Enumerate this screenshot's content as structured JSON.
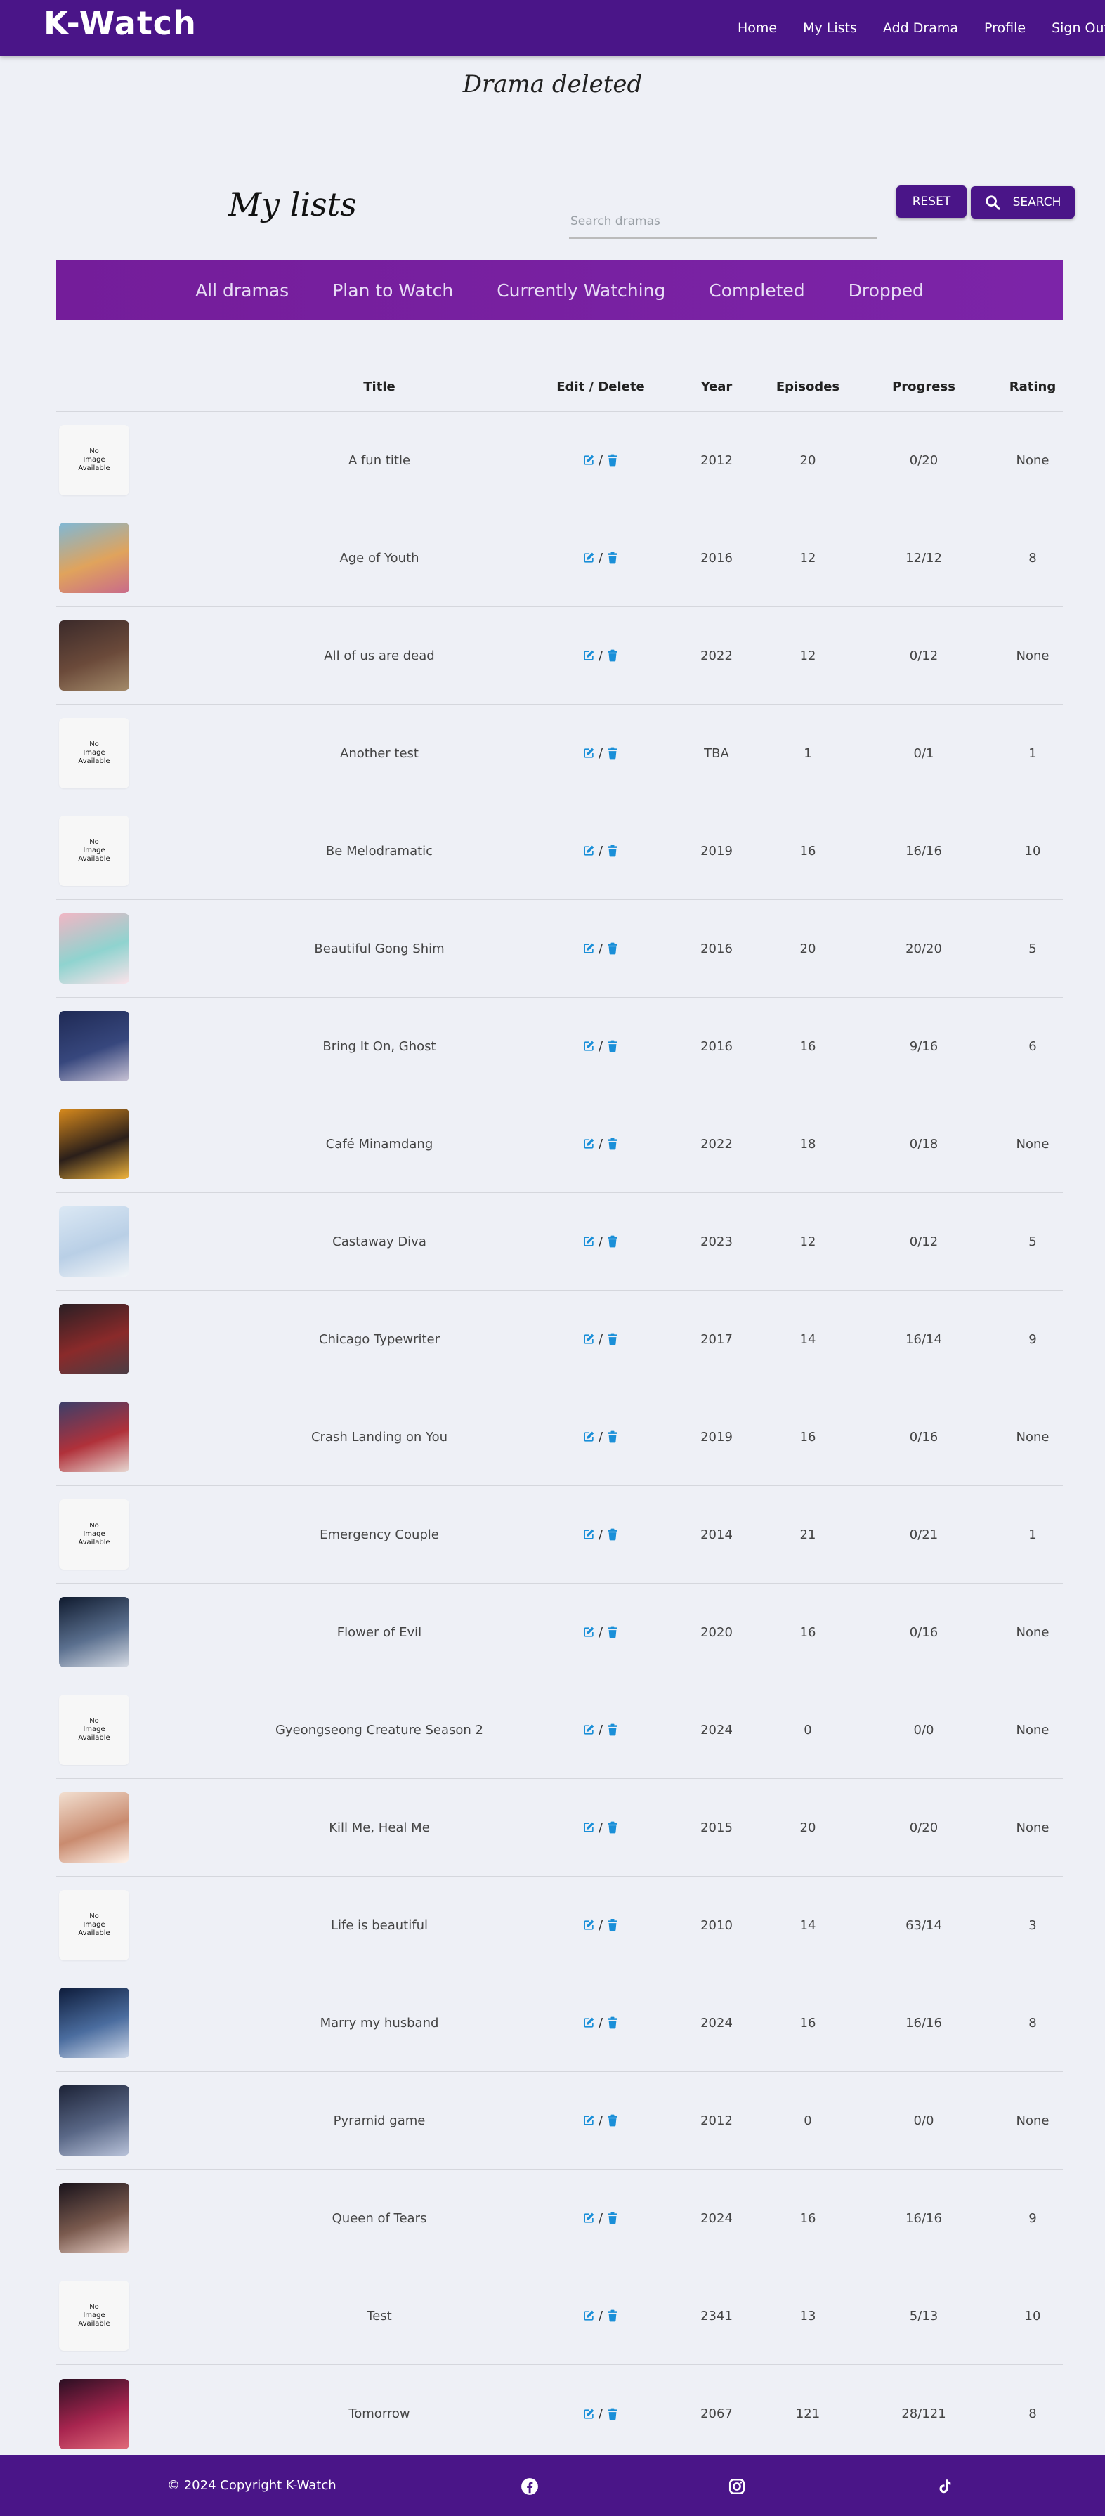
{
  "brand": "K-Watch",
  "nav": [
    "Home",
    "My Lists",
    "Add Drama",
    "Profile",
    "Sign Out"
  ],
  "flash": "Drama deleted",
  "page_title": "My lists",
  "search": {
    "placeholder": "Search dramas",
    "reset_label": "RESET",
    "search_label": "SEARCH"
  },
  "tabs": [
    "All dramas",
    "Plan to Watch",
    "Currently Watching",
    "Completed",
    "Dropped"
  ],
  "columns": [
    "Title",
    "Edit / Delete",
    "Year",
    "Episodes",
    "Progress",
    "Rating"
  ],
  "no_image": [
    "No",
    "Image",
    "Available"
  ],
  "rows": [
    {
      "title": "A fun title",
      "year": "2012",
      "episodes": "20",
      "progress": "0/20",
      "rating": "None",
      "has_image": false
    },
    {
      "title": "Age of Youth",
      "year": "2016",
      "episodes": "12",
      "progress": "12/12",
      "rating": "8",
      "has_image": true
    },
    {
      "title": "All of us are dead",
      "year": "2022",
      "episodes": "12",
      "progress": "0/12",
      "rating": "None",
      "has_image": true
    },
    {
      "title": "Another test",
      "year": "TBA",
      "episodes": "1",
      "progress": "0/1",
      "rating": "1",
      "has_image": false
    },
    {
      "title": "Be Melodramatic",
      "year": "2019",
      "episodes": "16",
      "progress": "16/16",
      "rating": "10",
      "has_image": false
    },
    {
      "title": "Beautiful Gong Shim",
      "year": "2016",
      "episodes": "20",
      "progress": "20/20",
      "rating": "5",
      "has_image": true
    },
    {
      "title": "Bring It On, Ghost",
      "year": "2016",
      "episodes": "16",
      "progress": "9/16",
      "rating": "6",
      "has_image": true
    },
    {
      "title": "Café Minamdang",
      "year": "2022",
      "episodes": "18",
      "progress": "0/18",
      "rating": "None",
      "has_image": true
    },
    {
      "title": "Castaway Diva",
      "year": "2023",
      "episodes": "12",
      "progress": "0/12",
      "rating": "5",
      "has_image": true
    },
    {
      "title": "Chicago Typewriter",
      "year": "2017",
      "episodes": "14",
      "progress": "16/14",
      "rating": "9",
      "has_image": true
    },
    {
      "title": "Crash Landing on You",
      "year": "2019",
      "episodes": "16",
      "progress": "0/16",
      "rating": "None",
      "has_image": true
    },
    {
      "title": "Emergency Couple",
      "year": "2014",
      "episodes": "21",
      "progress": "0/21",
      "rating": "1",
      "has_image": false
    },
    {
      "title": "Flower of Evil",
      "year": "2020",
      "episodes": "16",
      "progress": "0/16",
      "rating": "None",
      "has_image": true
    },
    {
      "title": "Gyeongseong Creature Season 2",
      "year": "2024",
      "episodes": "0",
      "progress": "0/0",
      "rating": "None",
      "has_image": false
    },
    {
      "title": "Kill Me, Heal Me",
      "year": "2015",
      "episodes": "20",
      "progress": "0/20",
      "rating": "None",
      "has_image": true
    },
    {
      "title": "Life is beautiful",
      "year": "2010",
      "episodes": "14",
      "progress": "63/14",
      "rating": "3",
      "has_image": false
    },
    {
      "title": "Marry my husband",
      "year": "2024",
      "episodes": "16",
      "progress": "16/16",
      "rating": "8",
      "has_image": true
    },
    {
      "title": "Pyramid game",
      "year": "2012",
      "episodes": "0",
      "progress": "0/0",
      "rating": "None",
      "has_image": true
    },
    {
      "title": "Queen of Tears",
      "year": "2024",
      "episodes": "16",
      "progress": "16/16",
      "rating": "9",
      "has_image": true
    },
    {
      "title": "Test",
      "year": "2341",
      "episodes": "13",
      "progress": "5/13",
      "rating": "10",
      "has_image": false
    },
    {
      "title": "Tomorrow",
      "year": "2067",
      "episodes": "121",
      "progress": "28/121",
      "rating": "8",
      "has_image": true
    }
  ],
  "footer": {
    "copyright": "© 2024 Copyright K-Watch",
    "social_icons": [
      "facebook-icon",
      "instagram-icon",
      "tiktok-icon"
    ]
  },
  "colors": {
    "primary": "#4a1588",
    "tabs_bar": "#7a22a6",
    "action_icon": "#1a8fd8",
    "background": "#eef0f6"
  }
}
